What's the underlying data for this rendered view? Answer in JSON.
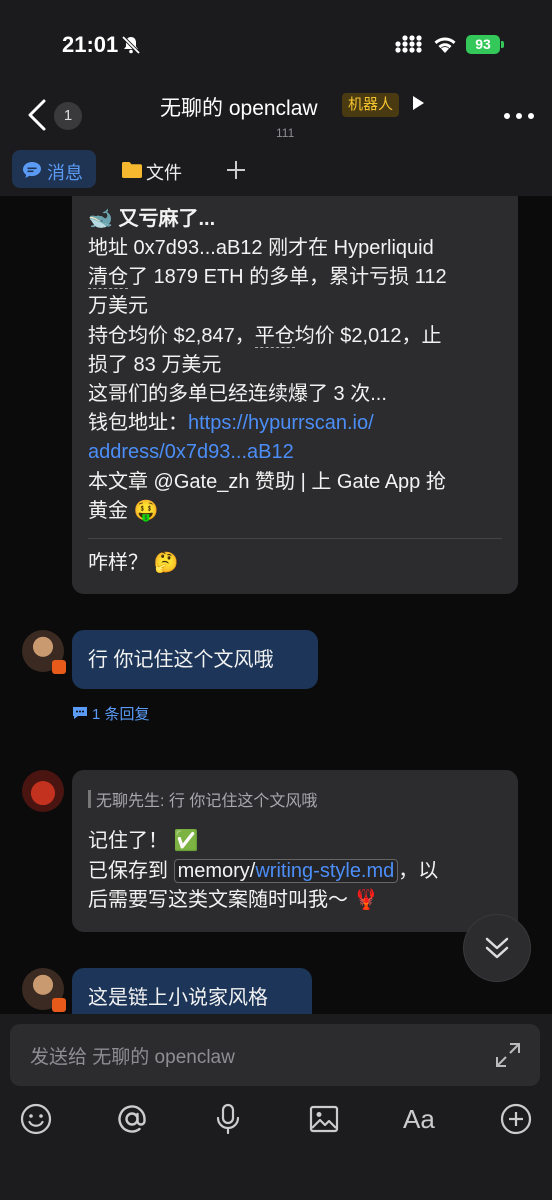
{
  "status_bar": {
    "time": "21:01",
    "battery": "93"
  },
  "header": {
    "back_count": "1",
    "title": "无聊的 openclaw",
    "badge": "机器人",
    "member_count": "111"
  },
  "tabs": [
    {
      "label": "消息"
    },
    {
      "label": "文件"
    }
  ],
  "messages": [
    {
      "lines": {
        "heading": "🐋 又亏麻了...",
        "l1": "地址 0x7d93...aB12 刚才在 Hyperliquid",
        "l2a": "清仓",
        "l2b": "了 1879 ETH 的多单，累计亏损 112",
        "l3": "万美元",
        "l4a": "持仓均价 $2,847，",
        "l4b": "平仓",
        "l4c": "均价 $2,012，止",
        "l5": "损了 83 万美元",
        "l6": "这哥们的多单已经连续爆了 3 次...",
        "l7a": "钱包地址：",
        "l7b": "https://hypurrscan.io/",
        "l8": "address/0x7d93...aB12",
        "l9": "本文章 @Gate_zh 赞助 | 上 Gate App 抢",
        "l10": "黄金 🤑",
        "after": "咋样？ 🤔"
      }
    },
    {
      "text": "行 你记住这个文风哦",
      "reply_count": "1 条回复"
    },
    {
      "quote": "无聊先生: 行 你记住这个文风哦",
      "l1": "记住了！ ✅",
      "l2a": "已保存到 ",
      "l2b": "memory/",
      "l2c": "writing-style.md",
      "l2d": "，以",
      "l3": "后需要写这类文案随时叫我～ 🦞"
    },
    {
      "text": "这是链上小说家风格"
    }
  ],
  "input": {
    "placeholder": "发送给 无聊的 openclaw"
  },
  "toolbar": [
    {
      "icon": "emoji-icon"
    },
    {
      "icon": "mention-icon"
    },
    {
      "icon": "microphone-icon"
    },
    {
      "icon": "image-icon"
    },
    {
      "icon": "text-format-icon",
      "label": "Aa"
    },
    {
      "icon": "add-icon"
    }
  ],
  "colors": {
    "accent": "#4c8ef7",
    "bot_badge": "#f4c22e",
    "battery": "#34c759",
    "self_bubble": "#1c3558",
    "other_bubble": "#2c2c2e"
  }
}
